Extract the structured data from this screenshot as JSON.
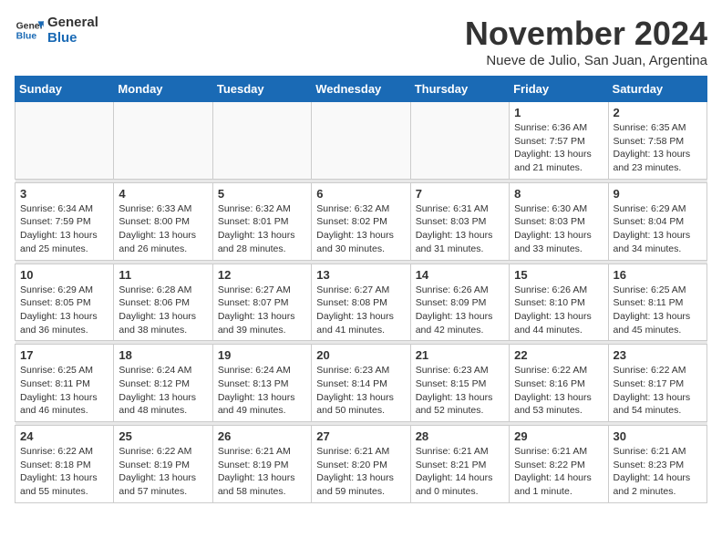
{
  "header": {
    "logo_line1": "General",
    "logo_line2": "Blue",
    "month": "November 2024",
    "location": "Nueve de Julio, San Juan, Argentina"
  },
  "weekdays": [
    "Sunday",
    "Monday",
    "Tuesday",
    "Wednesday",
    "Thursday",
    "Friday",
    "Saturday"
  ],
  "weeks": [
    [
      {
        "day": "",
        "info": ""
      },
      {
        "day": "",
        "info": ""
      },
      {
        "day": "",
        "info": ""
      },
      {
        "day": "",
        "info": ""
      },
      {
        "day": "",
        "info": ""
      },
      {
        "day": "1",
        "info": "Sunrise: 6:36 AM\nSunset: 7:57 PM\nDaylight: 13 hours\nand 21 minutes."
      },
      {
        "day": "2",
        "info": "Sunrise: 6:35 AM\nSunset: 7:58 PM\nDaylight: 13 hours\nand 23 minutes."
      }
    ],
    [
      {
        "day": "3",
        "info": "Sunrise: 6:34 AM\nSunset: 7:59 PM\nDaylight: 13 hours\nand 25 minutes."
      },
      {
        "day": "4",
        "info": "Sunrise: 6:33 AM\nSunset: 8:00 PM\nDaylight: 13 hours\nand 26 minutes."
      },
      {
        "day": "5",
        "info": "Sunrise: 6:32 AM\nSunset: 8:01 PM\nDaylight: 13 hours\nand 28 minutes."
      },
      {
        "day": "6",
        "info": "Sunrise: 6:32 AM\nSunset: 8:02 PM\nDaylight: 13 hours\nand 30 minutes."
      },
      {
        "day": "7",
        "info": "Sunrise: 6:31 AM\nSunset: 8:03 PM\nDaylight: 13 hours\nand 31 minutes."
      },
      {
        "day": "8",
        "info": "Sunrise: 6:30 AM\nSunset: 8:03 PM\nDaylight: 13 hours\nand 33 minutes."
      },
      {
        "day": "9",
        "info": "Sunrise: 6:29 AM\nSunset: 8:04 PM\nDaylight: 13 hours\nand 34 minutes."
      }
    ],
    [
      {
        "day": "10",
        "info": "Sunrise: 6:29 AM\nSunset: 8:05 PM\nDaylight: 13 hours\nand 36 minutes."
      },
      {
        "day": "11",
        "info": "Sunrise: 6:28 AM\nSunset: 8:06 PM\nDaylight: 13 hours\nand 38 minutes."
      },
      {
        "day": "12",
        "info": "Sunrise: 6:27 AM\nSunset: 8:07 PM\nDaylight: 13 hours\nand 39 minutes."
      },
      {
        "day": "13",
        "info": "Sunrise: 6:27 AM\nSunset: 8:08 PM\nDaylight: 13 hours\nand 41 minutes."
      },
      {
        "day": "14",
        "info": "Sunrise: 6:26 AM\nSunset: 8:09 PM\nDaylight: 13 hours\nand 42 minutes."
      },
      {
        "day": "15",
        "info": "Sunrise: 6:26 AM\nSunset: 8:10 PM\nDaylight: 13 hours\nand 44 minutes."
      },
      {
        "day": "16",
        "info": "Sunrise: 6:25 AM\nSunset: 8:11 PM\nDaylight: 13 hours\nand 45 minutes."
      }
    ],
    [
      {
        "day": "17",
        "info": "Sunrise: 6:25 AM\nSunset: 8:11 PM\nDaylight: 13 hours\nand 46 minutes."
      },
      {
        "day": "18",
        "info": "Sunrise: 6:24 AM\nSunset: 8:12 PM\nDaylight: 13 hours\nand 48 minutes."
      },
      {
        "day": "19",
        "info": "Sunrise: 6:24 AM\nSunset: 8:13 PM\nDaylight: 13 hours\nand 49 minutes."
      },
      {
        "day": "20",
        "info": "Sunrise: 6:23 AM\nSunset: 8:14 PM\nDaylight: 13 hours\nand 50 minutes."
      },
      {
        "day": "21",
        "info": "Sunrise: 6:23 AM\nSunset: 8:15 PM\nDaylight: 13 hours\nand 52 minutes."
      },
      {
        "day": "22",
        "info": "Sunrise: 6:22 AM\nSunset: 8:16 PM\nDaylight: 13 hours\nand 53 minutes."
      },
      {
        "day": "23",
        "info": "Sunrise: 6:22 AM\nSunset: 8:17 PM\nDaylight: 13 hours\nand 54 minutes."
      }
    ],
    [
      {
        "day": "24",
        "info": "Sunrise: 6:22 AM\nSunset: 8:18 PM\nDaylight: 13 hours\nand 55 minutes."
      },
      {
        "day": "25",
        "info": "Sunrise: 6:22 AM\nSunset: 8:19 PM\nDaylight: 13 hours\nand 57 minutes."
      },
      {
        "day": "26",
        "info": "Sunrise: 6:21 AM\nSunset: 8:19 PM\nDaylight: 13 hours\nand 58 minutes."
      },
      {
        "day": "27",
        "info": "Sunrise: 6:21 AM\nSunset: 8:20 PM\nDaylight: 13 hours\nand 59 minutes."
      },
      {
        "day": "28",
        "info": "Sunrise: 6:21 AM\nSunset: 8:21 PM\nDaylight: 14 hours\nand 0 minutes."
      },
      {
        "day": "29",
        "info": "Sunrise: 6:21 AM\nSunset: 8:22 PM\nDaylight: 14 hours\nand 1 minute."
      },
      {
        "day": "30",
        "info": "Sunrise: 6:21 AM\nSunset: 8:23 PM\nDaylight: 14 hours\nand 2 minutes."
      }
    ]
  ]
}
